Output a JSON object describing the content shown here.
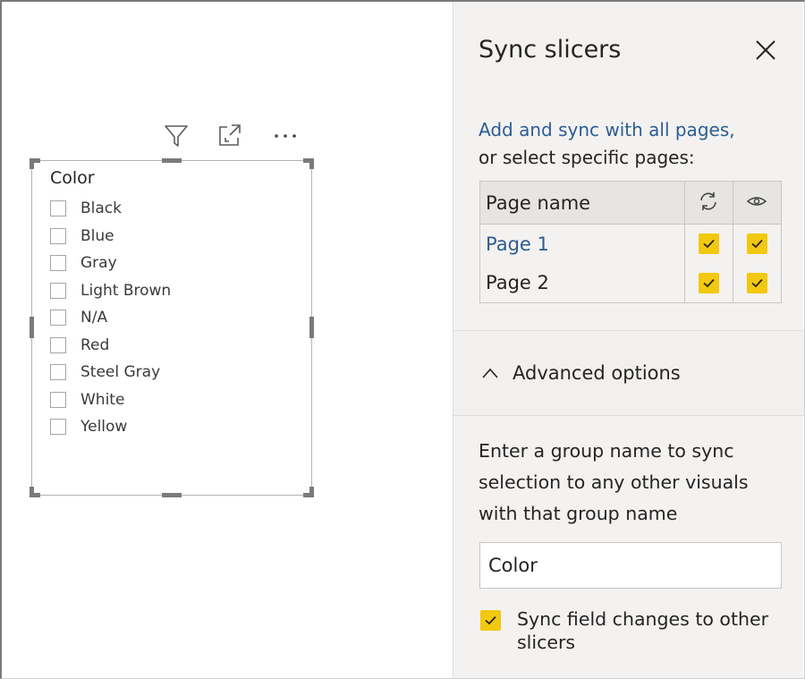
{
  "slicer": {
    "title": "Color",
    "items": [
      "Black",
      "Blue",
      "Gray",
      "Light Brown",
      "N/A",
      "Red",
      "Steel Gray",
      "White",
      "Yellow"
    ],
    "header_icons": [
      "filter-icon",
      "focus-mode-icon",
      "more-options-icon"
    ]
  },
  "pane": {
    "title": "Sync slicers",
    "close_icon": "close-icon",
    "intro_link": "Add and sync with all pages,",
    "intro_text": "or select specific pages:",
    "table": {
      "header_name": "Page name",
      "header_sync_icon": "sync-icon",
      "header_visible_icon": "eye-icon",
      "rows": [
        {
          "name": "Page 1",
          "sync": true,
          "visible": true
        },
        {
          "name": "Page 2",
          "sync": true,
          "visible": true
        }
      ]
    },
    "advanced": {
      "label": "Advanced options",
      "icon": "chevron-up-icon",
      "description": "Enter a group name to sync selection to any other visuals with that group name",
      "group_name_value": "Color",
      "sync_field_changes_label": "Sync field changes to other slicers",
      "sync_field_changes_checked": true
    }
  },
  "colors": {
    "accent_yellow": "#F2C811",
    "link_blue": "#2D5D93",
    "pane_bg": "#F3F2F1"
  }
}
